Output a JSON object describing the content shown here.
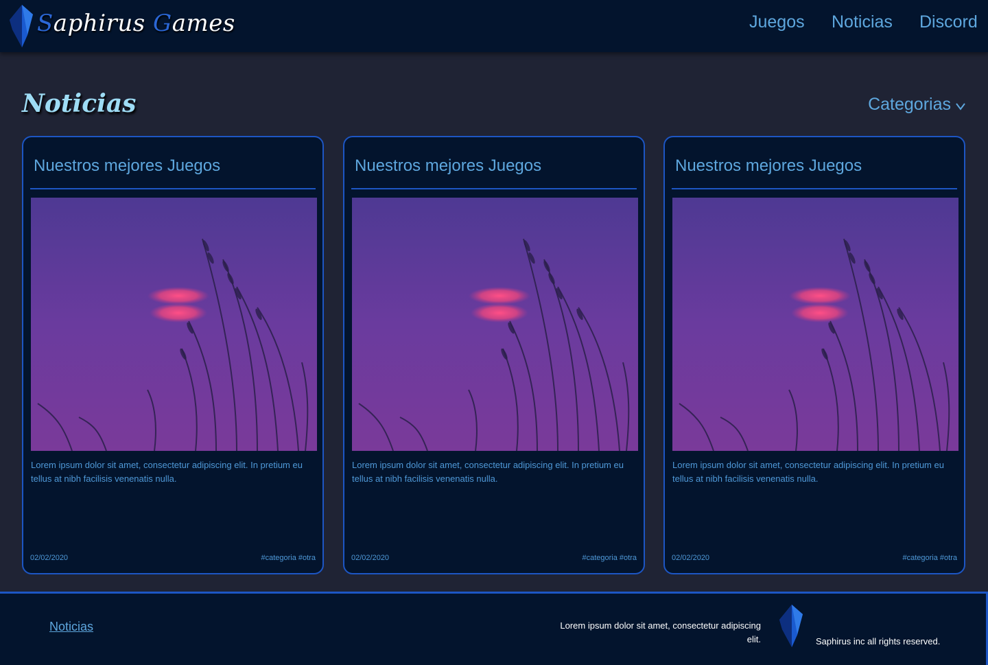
{
  "header": {
    "logo": {
      "first_cap": "S",
      "first_rest": "aphirus",
      "second_cap": "G",
      "second_rest": "ames"
    },
    "nav": [
      "Juegos",
      "Noticias",
      "Discord"
    ]
  },
  "page": {
    "title": "Noticias",
    "categories_label": "Categorias"
  },
  "cards": [
    {
      "title": "Nuestros mejores Juegos",
      "description": "Lorem ipsum dolor sit amet, consectetur adipiscing elit. In pretium eu tellus at nibh facilisis venenatis nulla.",
      "date": "02/02/2020",
      "tags": "#categoria #otra"
    },
    {
      "title": "Nuestros mejores Juegos",
      "description": "Lorem ipsum dolor sit amet, consectetur adipiscing elit. In pretium eu tellus at nibh facilisis venenatis nulla.",
      "date": "02/02/2020",
      "tags": "#categoria #otra"
    },
    {
      "title": "Nuestros mejores Juegos",
      "description": "Lorem ipsum dolor sit amet, consectetur adipiscing elit. In pretium eu tellus at nibh facilisis venenatis nulla.",
      "date": "02/02/2020",
      "tags": "#categoria #otra"
    }
  ],
  "footer": {
    "link": "Noticias",
    "text": "Lorem ipsum dolor sit amet, consectetur adipiscing elit.",
    "copyright": "Saphirus inc all rights reserved."
  },
  "colors": {
    "accent": "#1d56c4",
    "link": "#5ea7de",
    "panel": "#03142d",
    "background": "#1f2334"
  }
}
